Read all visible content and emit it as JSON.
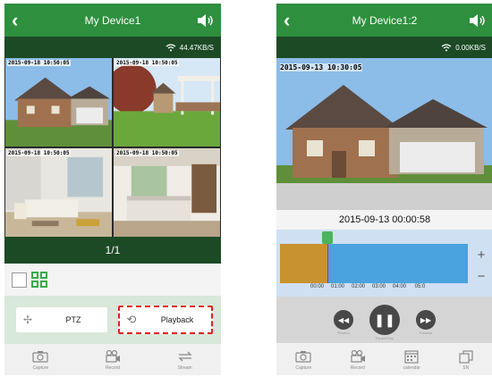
{
  "left_screen": {
    "title": "My Device1",
    "speed": "44.47KB/S",
    "tiles": [
      {
        "timestamp": "2015-09-18 10:50:05"
      },
      {
        "timestamp": "2015-09-18 10:50:05"
      },
      {
        "timestamp": "2015-09-18 10:50:05"
      },
      {
        "timestamp": "2015-09-18 10:50:05"
      }
    ],
    "page_indicator": "1/1",
    "ptz_label": "PTZ",
    "playback_label": "Playback",
    "tabs": [
      {
        "label": "Capture",
        "icon": "camera-icon"
      },
      {
        "label": "Record",
        "icon": "video-record-icon"
      },
      {
        "label": "Stream",
        "icon": "stream-swap-icon"
      }
    ]
  },
  "right_screen": {
    "title": "My Device1:2",
    "speed": "0.00KB/S",
    "video_timestamp": "2015-09-13 10:30:05",
    "playback_datetime": "2015-09-13  00:00:58",
    "timeline": {
      "labels": [
        "00:00",
        "01:00",
        "02:00",
        "03:00",
        "04:00",
        "05:0"
      ],
      "zoom_in": "+",
      "zoom_out": "−",
      "recorded_until": 0.25
    },
    "controls": [
      {
        "name": "rewind",
        "label": "Rewind",
        "icon": "rewind-icon"
      },
      {
        "name": "pause",
        "label": "Pause/Stop",
        "icon": "pause-icon"
      },
      {
        "name": "forward",
        "label": "Forward",
        "icon": "fast-forward-icon"
      }
    ],
    "tabs": [
      {
        "label": "Capture",
        "icon": "camera-icon"
      },
      {
        "label": "Record",
        "icon": "video-record-icon"
      },
      {
        "label": "calendar",
        "icon": "calendar-icon"
      },
      {
        "label": "SN",
        "icon": "copy-icon"
      }
    ]
  },
  "colors": {
    "header": "#2e8f3e",
    "dark_bar": "#1c4a24",
    "accent_green": "#3aaa4c",
    "highlight_red": "#e02020",
    "timeline_blue": "#4aa3de",
    "timeline_recorded": "#c8932e"
  }
}
